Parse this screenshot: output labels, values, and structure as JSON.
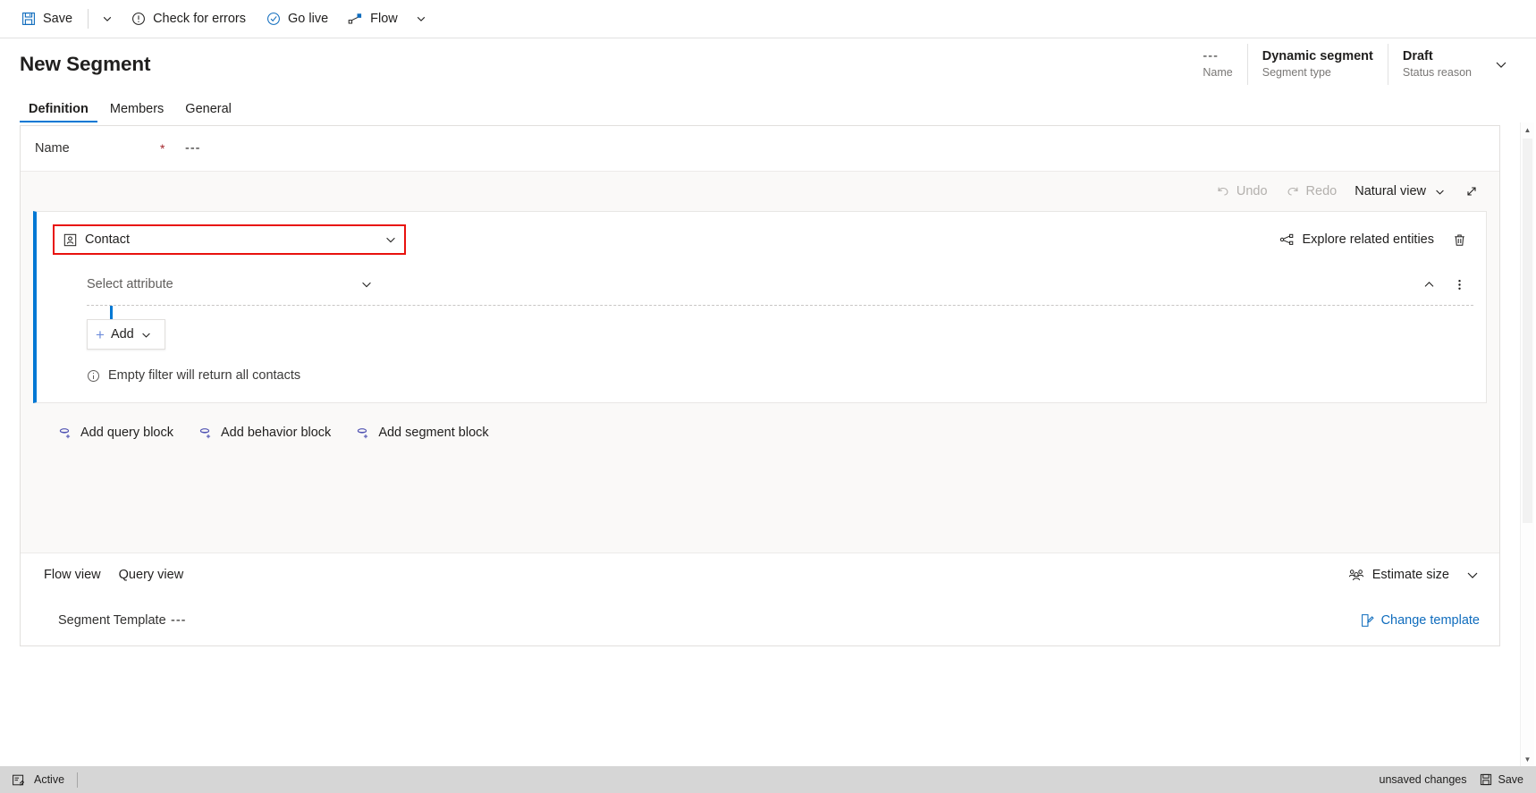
{
  "commandbar": {
    "items": [
      {
        "id": "save",
        "label": "Save",
        "icon": "save-icon"
      },
      {
        "id": "save-caret",
        "label": "",
        "icon": "chevron-down-icon"
      },
      {
        "id": "check-errors",
        "label": "Check for errors",
        "icon": "error-circle-icon"
      },
      {
        "id": "go-live",
        "label": "Go live",
        "icon": "check-circle-icon"
      },
      {
        "id": "flow",
        "label": "Flow",
        "icon": "flow-icon"
      },
      {
        "id": "flow-caret",
        "label": "",
        "icon": "chevron-down-icon"
      }
    ]
  },
  "header": {
    "title": "New Segment",
    "fields": [
      {
        "value": "---",
        "label": "Name"
      },
      {
        "value": "Dynamic segment",
        "label": "Segment type"
      },
      {
        "value": "Draft",
        "label": "Status reason"
      }
    ],
    "expand_icon": "chevron-down-icon"
  },
  "tabs": [
    {
      "label": "Definition",
      "active": true
    },
    {
      "label": "Members",
      "active": false
    },
    {
      "label": "General",
      "active": false
    }
  ],
  "name_row": {
    "label": "Name",
    "required_marker": "*",
    "value": "---"
  },
  "designer_toolbar": {
    "undo": "Undo",
    "redo": "Redo",
    "view_mode": "Natural view",
    "expand_icon": "expand-diagonal-icon"
  },
  "query_block": {
    "entity": "Contact",
    "entity_icon": "contact-entity-icon",
    "entity_highlight_color": "#e8120e",
    "explore_label": "Explore related entities",
    "delete_icon": "trash-icon",
    "attribute_placeholder": "Select attribute",
    "collapse_icon": "chevron-up-icon",
    "more_icon": "more-vertical-icon",
    "add_label": "Add",
    "empty_filter_note": "Empty filter will return all contacts",
    "accent_color": "#0078d4"
  },
  "add_blocks": [
    {
      "label": "Add query block",
      "icon": "add-query-block-icon"
    },
    {
      "label": "Add behavior block",
      "icon": "add-behavior-block-icon"
    },
    {
      "label": "Add segment block",
      "icon": "add-segment-block-icon"
    }
  ],
  "views_bar": {
    "tabs": [
      {
        "label": "Flow view"
      },
      {
        "label": "Query view"
      }
    ],
    "estimate_label": "Estimate size",
    "estimate_icon": "people-icon",
    "expand_icon": "chevron-down-icon"
  },
  "template_row": {
    "label": "Segment Template",
    "value": "---",
    "change_label": "Change template",
    "change_icon": "edit-document-icon"
  },
  "statusbar": {
    "state_icon": "form-icon",
    "state": "Active",
    "unsaved": "unsaved changes",
    "save_label": "Save",
    "save_icon": "save-icon"
  }
}
